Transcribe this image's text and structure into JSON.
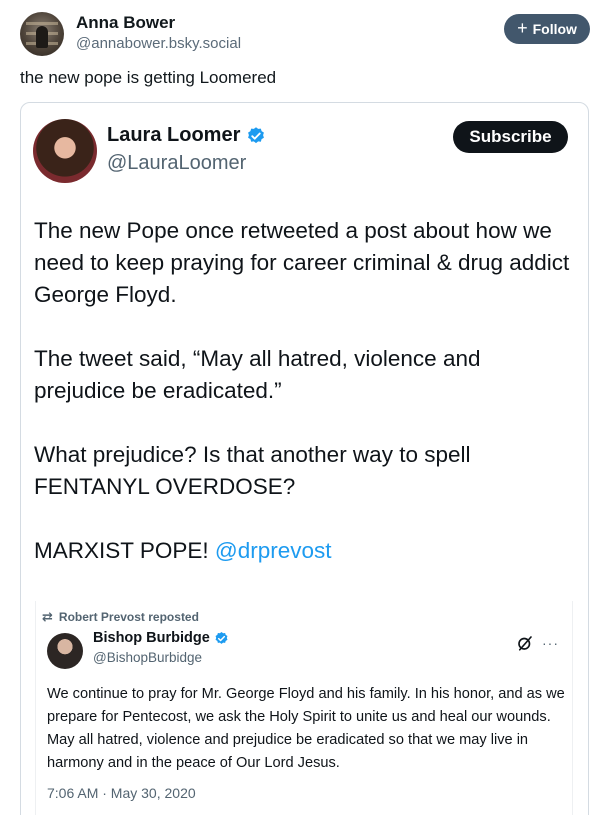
{
  "post": {
    "author_name": "Anna Bower",
    "author_handle": "@annabower.bsky.social",
    "follow_label": "Follow",
    "text": "the new pope is getting Loomered"
  },
  "embed": {
    "author_name": "Laura Loomer",
    "author_handle": "@LauraLoomer",
    "subscribe_label": "Subscribe",
    "paragraphs": [
      "The new Pope once retweeted a post about how we need to keep praying for career criminal & drug addict George Floyd.",
      "The tweet said, “May all hatred, violence and prejudice be eradicated.”",
      "What prejudice? Is that another way to spell FENTANYL OVERDOSE?"
    ],
    "last_paragraph_text": "MARXIST POPE! ",
    "mention": "@drprevost",
    "repost": {
      "reposted_by": "Robert Prevost reposted",
      "author_name": "Bishop Burbidge",
      "author_handle": "@BishopBurbidge",
      "text": "We continue to pray for Mr. George Floyd and his family. In his honor, and as we prepare for Pentecost, we ask the Holy Spirit to unite us and heal our wounds. May all hatred, violence and prejudice be eradicated so that we may live in harmony and in the peace of Our Lord Jesus.",
      "timestamp": "7:06 AM · May 30, 2020"
    }
  },
  "colors": {
    "follow_button": "#42576c",
    "subscribe_button": "#0f1419",
    "verified_badge": "#1d9bf0",
    "mention": "#1d9bf0"
  },
  "icons": [
    "plus-icon",
    "verified-badge-icon",
    "retweet-icon",
    "grok-icon",
    "more-icon"
  ]
}
